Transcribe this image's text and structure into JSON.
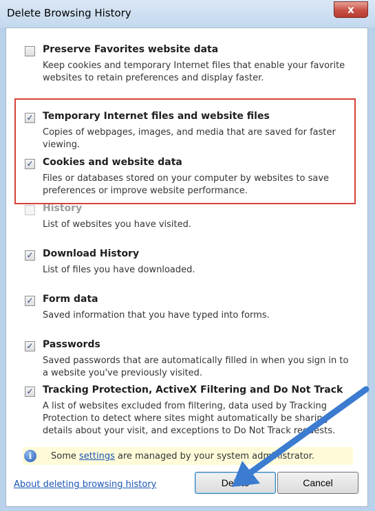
{
  "window": {
    "title": "Delete Browsing History",
    "close_label": "x"
  },
  "items": [
    {
      "label": "Preserve Favorites website data",
      "description": "Keep cookies and temporary Internet files that enable your favorite websites to retain preferences and display faster.",
      "checked": false,
      "enabled": true
    },
    {
      "label": "Temporary Internet files and website files",
      "description": "Copies of webpages, images, and media that are saved for faster viewing.",
      "checked": true,
      "enabled": true
    },
    {
      "label": "Cookies and website data",
      "description": "Files or databases stored on your computer by websites to save preferences or improve website performance.",
      "checked": true,
      "enabled": true
    },
    {
      "label": "History",
      "description": "List of websites you have visited.",
      "checked": false,
      "enabled": false
    },
    {
      "label": "Download History",
      "description": "List of files you have downloaded.",
      "checked": true,
      "enabled": true
    },
    {
      "label": "Form data",
      "description": "Saved information that you have typed into forms.",
      "checked": true,
      "enabled": true
    },
    {
      "label": "Passwords",
      "description": "Saved passwords that are automatically filled in when you sign in to a website you've previously visited.",
      "checked": true,
      "enabled": true
    },
    {
      "label": "Tracking Protection, ActiveX Filtering and Do Not Track",
      "description": "A list of websites excluded from filtering, data used by Tracking Protection to detect where sites might automatically be sharing details about your visit, and exceptions to Do Not Track requests.",
      "checked": true,
      "enabled": true
    }
  ],
  "check_glyph": "✓",
  "info": {
    "icon": "info-icon",
    "icon_glyph": "i",
    "text_before": "Some ",
    "link_text": "settings",
    "text_after": " are managed by your system administrator."
  },
  "footer": {
    "about_link": "About deleting browsing history",
    "delete_label": "Delete",
    "cancel_label": "Cancel"
  },
  "colors": {
    "highlight_border": "#d6413a",
    "annotation_arrow": "#3b7bd0"
  }
}
